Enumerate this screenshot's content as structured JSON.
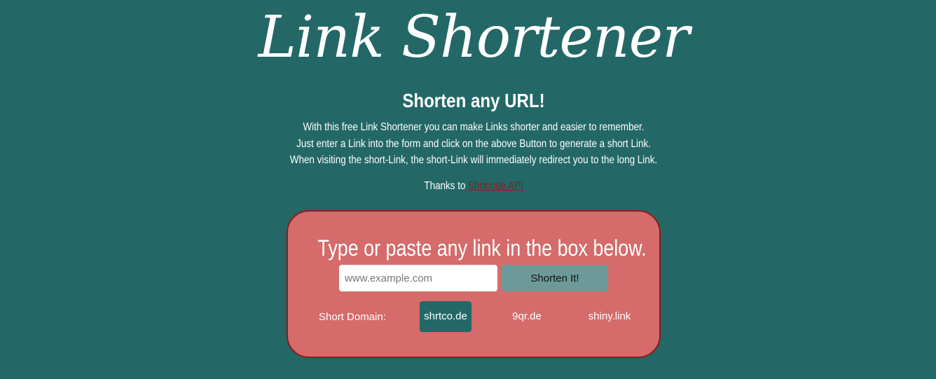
{
  "header": {
    "title": "Link Shortener",
    "subtitle": "Shorten any URL!",
    "description": [
      "With this free Link Shortener you can make Links shorter and easier to remember.",
      "Just enter a Link into the form and click on the above Button to generate a short Link.",
      "When visiting the short-Link, the short-Link will immediately redirect you to the long Link."
    ],
    "thanks_prefix": "Thanks to ",
    "thanks_link": "Shrtcode API"
  },
  "form": {
    "heading": "Type or paste any link in the box below.",
    "input_placeholder": "www.example.com",
    "input_value": "",
    "button_label": "Shorten It!",
    "domain_label": "Short Domain:",
    "domains": [
      "shrtco.de",
      "9qr.de",
      "shiny.link"
    ],
    "selected_domain": "shrtco.de"
  },
  "colors": {
    "background": "#236866",
    "card": "#d56b6b",
    "card_border": "#8e1b1b",
    "link": "#8e1b1b",
    "button": "#6b9a98",
    "selected_domain_bg": "#236866"
  }
}
